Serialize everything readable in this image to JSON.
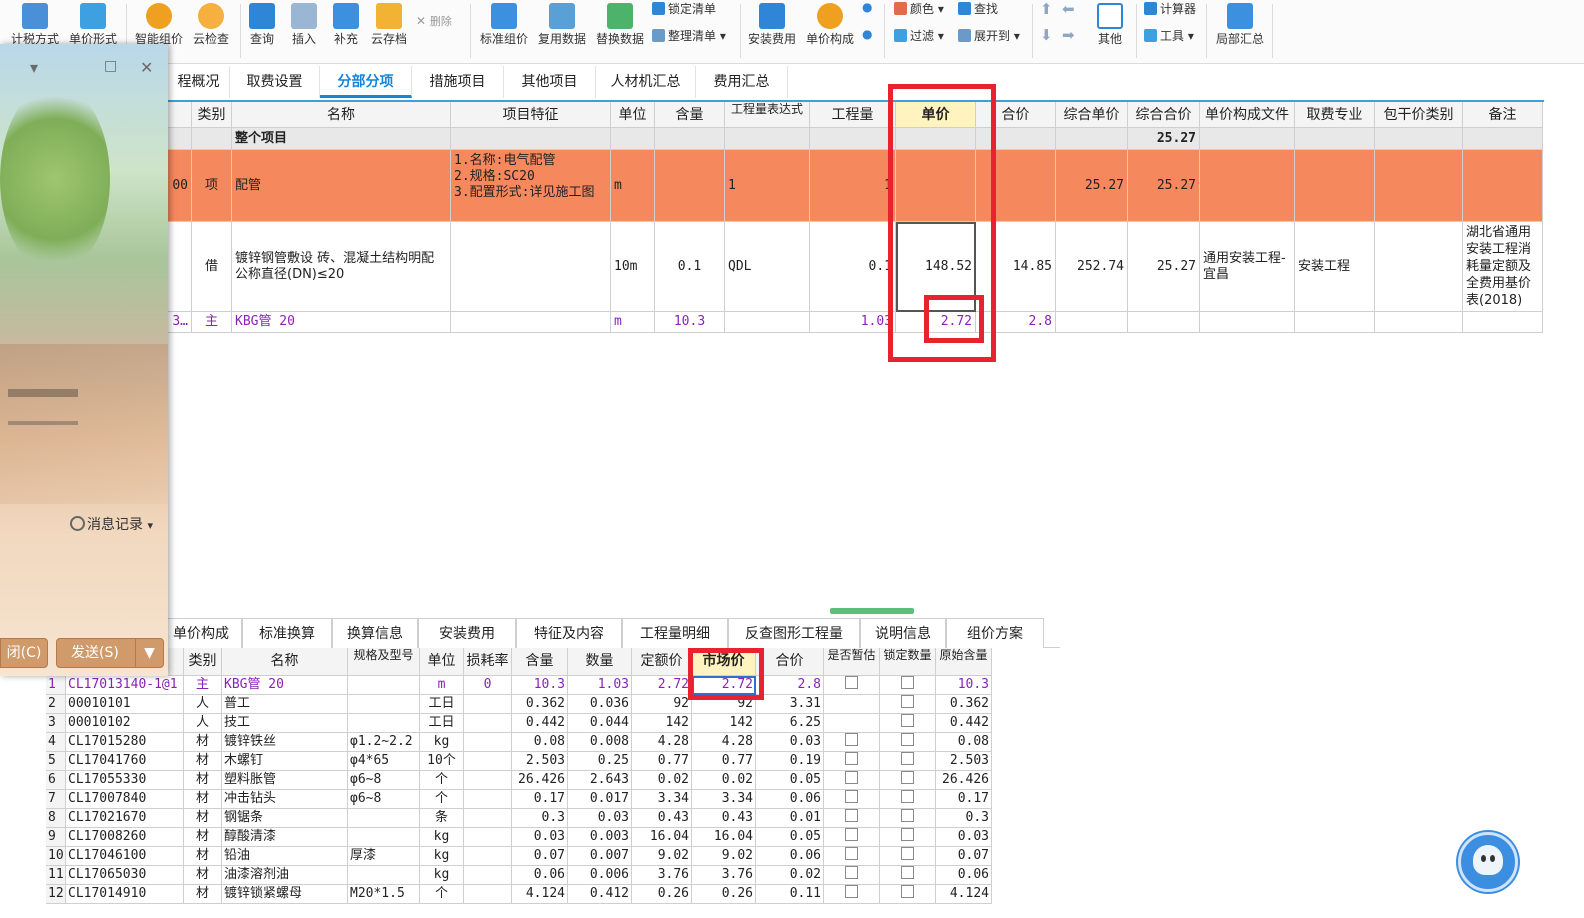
{
  "toolbar": {
    "buttons": [
      {
        "label": "计税方式",
        "icon": "tax-method-icon"
      },
      {
        "label": "单价形式",
        "icon": "price-form-icon"
      },
      {
        "label": "智能组价",
        "icon": "smart-pricing-icon"
      },
      {
        "label": "云检查",
        "icon": "cloud-check-icon"
      },
      {
        "label": "查询",
        "icon": "query-icon"
      },
      {
        "label": "插入",
        "icon": "insert-icon"
      },
      {
        "label": "补充",
        "icon": "supplement-icon"
      },
      {
        "label": "云存档",
        "icon": "cloud-archive-icon"
      },
      {
        "label": "删除",
        "icon": "delete-icon"
      },
      {
        "label": "标准组价",
        "icon": "standard-pricing-icon"
      },
      {
        "label": "复用数据",
        "icon": "reuse-data-icon"
      },
      {
        "label": "替换数据",
        "icon": "replace-data-icon"
      },
      {
        "label": "锁定清单",
        "icon": "lock-list-icon"
      },
      {
        "label": "整理清单",
        "icon": "organize-list-icon"
      },
      {
        "label": "安装费用",
        "icon": "install-fee-icon"
      },
      {
        "label": "单价构成",
        "icon": "price-composition-icon"
      },
      {
        "label": "颜色",
        "icon": "color-icon"
      },
      {
        "label": "查找",
        "icon": "find-icon"
      },
      {
        "label": "过滤",
        "icon": "filter-icon"
      },
      {
        "label": "展开到",
        "icon": "expand-to-icon"
      },
      {
        "label": "其他",
        "icon": "other-icon"
      },
      {
        "label": "计算器",
        "icon": "calculator-icon"
      },
      {
        "label": "工具",
        "icon": "tools-icon"
      },
      {
        "label": "局部汇总",
        "icon": "partial-summary-icon"
      }
    ]
  },
  "main_tabs": [
    "程概况",
    "取费设置",
    "分部分项",
    "措施项目",
    "其他项目",
    "人材机汇总",
    "费用汇总"
  ],
  "active_main_tab": "分部分项",
  "top_table": {
    "columns": [
      "类别",
      "名称",
      "项目特征",
      "单位",
      "含量",
      "工程量表达式",
      "工程量",
      "单价",
      "合价",
      "综合单价",
      "综合合价",
      "单价构成文件",
      "取费专业",
      "包干价类别",
      "备注"
    ],
    "total_row": {
      "name": "整个项目",
      "comp_total": "25.27"
    },
    "rows": [
      {
        "code": "00",
        "type": "项",
        "name": "配管",
        "features": "1.名称:电气配管\n2.规格:SC20\n3.配置形式:详见施工图",
        "unit": "m",
        "content": "",
        "qty_expr": "1",
        "qty": "1",
        "unit_price": "",
        "total_price": "",
        "comp_unit": "25.27",
        "comp_total": "25.27",
        "price_file": "",
        "fee_major": "",
        "lump_type": "",
        "remark": ""
      },
      {
        "code": "",
        "type": "借",
        "name": "镀锌钢管敷设 砖、混凝土结构明配 公称直径(DN)≤20",
        "features": "",
        "unit": "10m",
        "content": "0.1",
        "qty_expr": "QDL",
        "qty": "0.1",
        "unit_price": "148.52",
        "total_price": "14.85",
        "comp_unit": "252.74",
        "comp_total": "25.27",
        "price_file": "通用安装工程-宜昌",
        "fee_major": "安装工程",
        "lump_type": "",
        "remark": "湖北省通用安装工程消耗量定额及全费用基价表(2018)"
      },
      {
        "code": "3…",
        "type": "主",
        "name": "KBG管 20",
        "features": "",
        "unit": "m",
        "content": "10.3",
        "qty_expr": "",
        "qty": "1.03",
        "unit_price": "2.72",
        "total_price": "2.8",
        "comp_unit": "",
        "comp_total": "",
        "price_file": "",
        "fee_major": "",
        "lump_type": "",
        "remark": ""
      }
    ]
  },
  "bottom_tabs": [
    "单价构成",
    "标准换算",
    "换算信息",
    "安装费用",
    "特征及内容",
    "工程量明细",
    "反查图形工程量",
    "说明信息",
    "组价方案"
  ],
  "bottom_table": {
    "columns": [
      "",
      "编码",
      "类别",
      "名称",
      "规格及型号",
      "单位",
      "损耗率",
      "含量",
      "数量",
      "定额价",
      "市场价",
      "合价",
      "是否暂估",
      "锁定数量",
      "原始含量"
    ],
    "rows": [
      {
        "no": "1",
        "code": "CL17013140-1@1",
        "type": "主",
        "name": "KBG管 20",
        "spec": "",
        "unit": "m",
        "loss": "0",
        "content": "10.3",
        "qty": "1.03",
        "quota": "2.72",
        "market": "2.72",
        "total": "2.8",
        "est": true,
        "lock": true,
        "orig": "10.3"
      },
      {
        "no": "2",
        "code": "00010101",
        "type": "人",
        "name": "普工",
        "spec": "",
        "unit": "工日",
        "loss": "",
        "content": "0.362",
        "qty": "0.036",
        "quota": "92",
        "market": "92",
        "total": "3.31",
        "est": false,
        "lock": true,
        "orig": "0.362"
      },
      {
        "no": "3",
        "code": "00010102",
        "type": "人",
        "name": "技工",
        "spec": "",
        "unit": "工日",
        "loss": "",
        "content": "0.442",
        "qty": "0.044",
        "quota": "142",
        "market": "142",
        "total": "6.25",
        "est": false,
        "lock": true,
        "orig": "0.442"
      },
      {
        "no": "4",
        "code": "CL17015280",
        "type": "材",
        "name": "镀锌铁丝",
        "spec": "φ1.2~2.2",
        "unit": "kg",
        "loss": "",
        "content": "0.08",
        "qty": "0.008",
        "quota": "4.28",
        "market": "4.28",
        "total": "0.03",
        "est": true,
        "lock": true,
        "orig": "0.08"
      },
      {
        "no": "5",
        "code": "CL17041760",
        "type": "材",
        "name": "木螺钉",
        "spec": "φ4*65",
        "unit": "10个",
        "loss": "",
        "content": "2.503",
        "qty": "0.25",
        "quota": "0.77",
        "market": "0.77",
        "total": "0.19",
        "est": true,
        "lock": true,
        "orig": "2.503"
      },
      {
        "no": "6",
        "code": "CL17055330",
        "type": "材",
        "name": "塑料胀管",
        "spec": "φ6~8",
        "unit": "个",
        "loss": "",
        "content": "26.426",
        "qty": "2.643",
        "quota": "0.02",
        "market": "0.02",
        "total": "0.05",
        "est": true,
        "lock": true,
        "orig": "26.426"
      },
      {
        "no": "7",
        "code": "CL17007840",
        "type": "材",
        "name": "冲击钻头",
        "spec": "φ6~8",
        "unit": "个",
        "loss": "",
        "content": "0.17",
        "qty": "0.017",
        "quota": "3.34",
        "market": "3.34",
        "total": "0.06",
        "est": true,
        "lock": true,
        "orig": "0.17"
      },
      {
        "no": "8",
        "code": "CL17021670",
        "type": "材",
        "name": "钢锯条",
        "spec": "",
        "unit": "条",
        "loss": "",
        "content": "0.3",
        "qty": "0.03",
        "quota": "0.43",
        "market": "0.43",
        "total": "0.01",
        "est": true,
        "lock": true,
        "orig": "0.3"
      },
      {
        "no": "9",
        "code": "CL17008260",
        "type": "材",
        "name": "醇酸清漆",
        "spec": "",
        "unit": "kg",
        "loss": "",
        "content": "0.03",
        "qty": "0.003",
        "quota": "16.04",
        "market": "16.04",
        "total": "0.05",
        "est": true,
        "lock": true,
        "orig": "0.03"
      },
      {
        "no": "10",
        "code": "CL17046100",
        "type": "材",
        "name": "铅油",
        "spec": "厚漆",
        "unit": "kg",
        "loss": "",
        "content": "0.07",
        "qty": "0.007",
        "quota": "9.02",
        "market": "9.02",
        "total": "0.06",
        "est": true,
        "lock": true,
        "orig": "0.07"
      },
      {
        "no": "11",
        "code": "CL17065030",
        "type": "材",
        "name": "油漆溶剂油",
        "spec": "",
        "unit": "kg",
        "loss": "",
        "content": "0.06",
        "qty": "0.006",
        "quota": "3.76",
        "market": "3.76",
        "total": "0.02",
        "est": true,
        "lock": true,
        "orig": "0.06"
      },
      {
        "no": "12",
        "code": "CL17014910",
        "type": "材",
        "name": "镀锌锁紧螺母",
        "spec": "M20*1.5",
        "unit": "个",
        "loss": "",
        "content": "4.124",
        "qty": "0.412",
        "quota": "0.26",
        "market": "0.26",
        "total": "0.11",
        "est": true,
        "lock": true,
        "orig": "4.124"
      }
    ]
  },
  "chat_panel": {
    "message_record": "消息记录",
    "close_label": "闭(C)",
    "send_label": "发送(S)"
  },
  "colors": {
    "accent_blue": "#1685d8",
    "orange_row": "#f6885e",
    "annotation_red": "#e8232f",
    "purple_text": "#8b22b8"
  }
}
